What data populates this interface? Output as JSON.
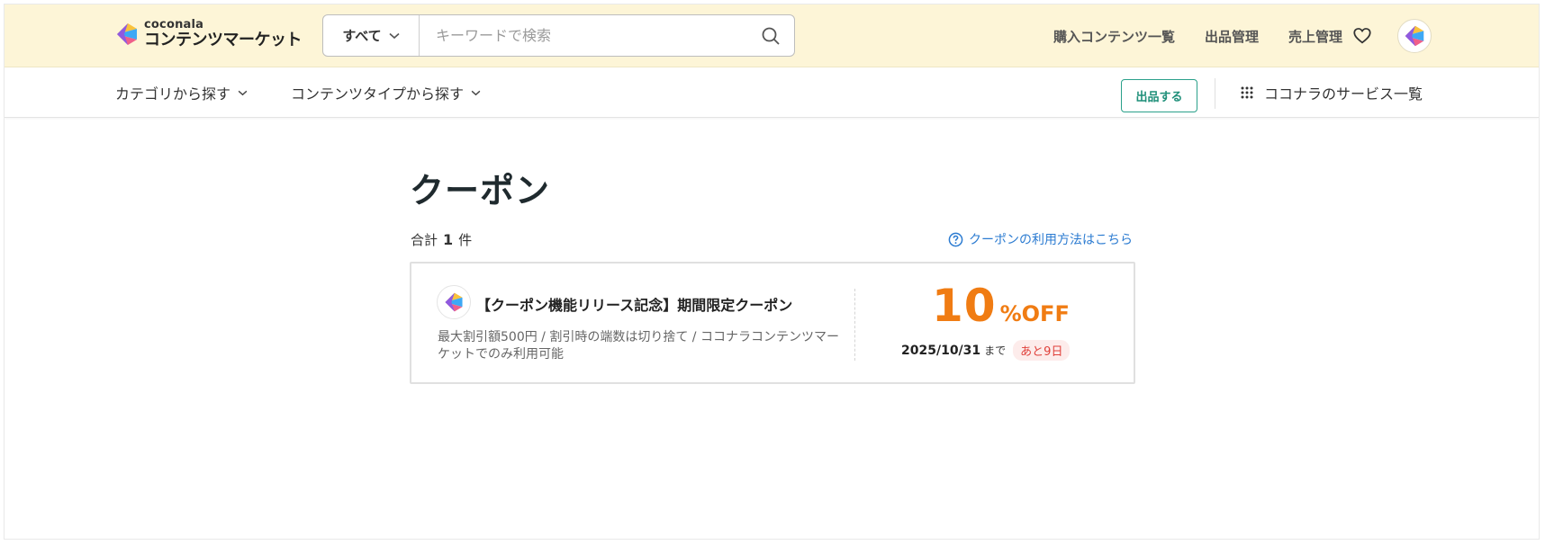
{
  "header": {
    "logo": {
      "small": "coconala",
      "big": "コンテンツマーケット",
      "icon": "coconala-logo-icon"
    },
    "search": {
      "category_label": "すべて",
      "placeholder": "キーワードで検索",
      "value": ""
    },
    "nav": [
      "購入コンテンツ一覧",
      "出品管理",
      "売上管理"
    ],
    "icons": {
      "favorite": "heart-icon",
      "avatar": "user-avatar"
    }
  },
  "subnav": {
    "category_label": "カテゴリから探す",
    "type_label": "コンテンツタイプから探す",
    "sell_label": "出品する",
    "services_label": "ココナラのサービス一覧"
  },
  "main": {
    "title": "クーポン",
    "total_prefix": "合計",
    "total_count": "1",
    "total_suffix": "件",
    "howto_label": "クーポンの利用方法はこちら"
  },
  "coupon": {
    "title": "【クーポン機能リリース記念】期間限定クーポン",
    "description": "最大割引額500円 / 割引時の端数は切り捨て / ココナラコンテンツマーケットでのみ利用可能",
    "discount_value": "10",
    "discount_unit": "%",
    "discount_off": "OFF",
    "expiry_date": "2025/10/31",
    "expiry_suffix": "まで",
    "remaining": "あと9日"
  },
  "colors": {
    "header_bg": "#fdf5d7",
    "accent_green": "#1e8f79",
    "discount_orange": "#f07c13",
    "link_blue": "#2b7bd1",
    "badge_red": "#e0413b"
  }
}
